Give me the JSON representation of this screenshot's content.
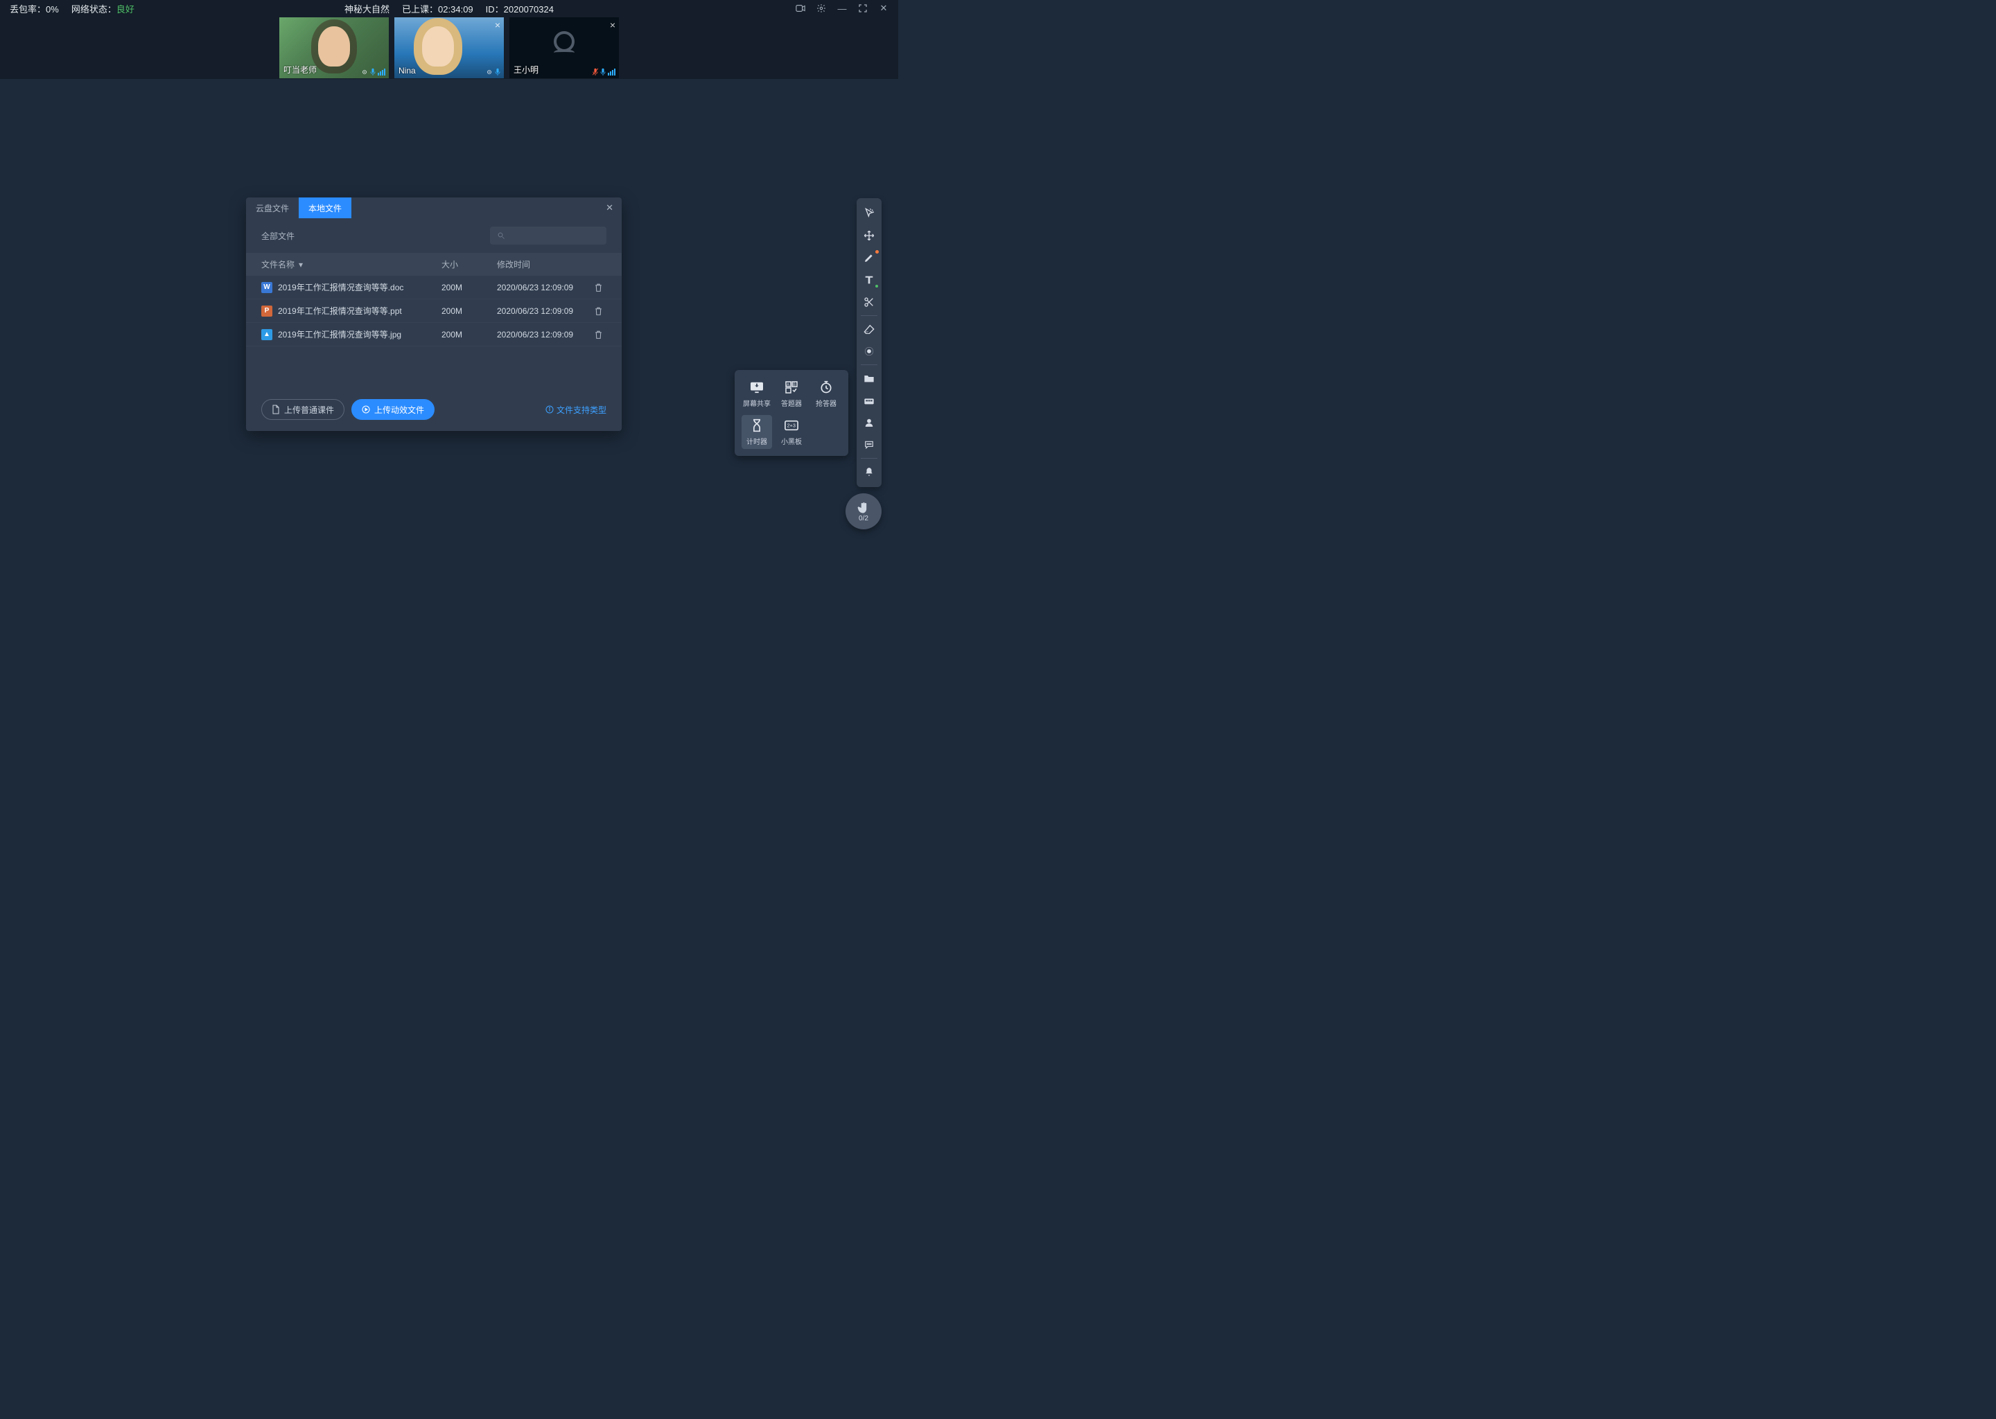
{
  "status": {
    "loss_label": "丢包率：",
    "loss_value": "0%",
    "net_label": "网络状态：",
    "net_value": "良好",
    "title": "神秘大自然",
    "elapsed_label": "已上课：",
    "elapsed_value": "02:34:09",
    "id_label": "ID：",
    "id_value": "2020070324"
  },
  "participants": [
    {
      "name": "叮当老师",
      "camera_on": true,
      "mic": "on",
      "closable": false
    },
    {
      "name": "Nina",
      "camera_on": true,
      "mic": "on",
      "closable": true
    },
    {
      "name": "王小明",
      "camera_on": false,
      "mic": "muted",
      "closable": true
    }
  ],
  "dialog": {
    "tab_cloud": "云盘文件",
    "tab_local": "本地文件",
    "filter_label": "全部文件",
    "col_name": "文件名称",
    "col_size": "大小",
    "col_mtime": "修改时间",
    "rows": [
      {
        "icon": "w",
        "letter": "W",
        "name": "2019年工作汇报情况查询等等.doc",
        "size": "200M",
        "mtime": "2020/06/23 12:09:09"
      },
      {
        "icon": "p",
        "letter": "P",
        "name": "2019年工作汇报情况查询等等.ppt",
        "size": "200M",
        "mtime": "2020/06/23 12:09:09"
      },
      {
        "icon": "i",
        "letter": "▲",
        "name": "2019年工作汇报情况查询等等.jpg",
        "size": "200M",
        "mtime": "2020/06/23 12:09:09"
      }
    ],
    "upload_plain": "上传普通课件",
    "upload_anim": "上传动效文件",
    "support_link": "文件支持类型"
  },
  "toolbox": [
    {
      "key": "screen-share",
      "label": "屏幕共享"
    },
    {
      "key": "answer-tool",
      "label": "答题器"
    },
    {
      "key": "buzzer",
      "label": "抢答器"
    },
    {
      "key": "timer",
      "label": "计时器"
    },
    {
      "key": "mini-board",
      "label": "小黑板"
    }
  ],
  "rail": [
    "pointer",
    "move",
    "pen",
    "text",
    "scissors",
    "eraser",
    "spotlight",
    "folder",
    "apps",
    "user",
    "chat",
    "bell"
  ],
  "hand": {
    "count": "0/2"
  }
}
